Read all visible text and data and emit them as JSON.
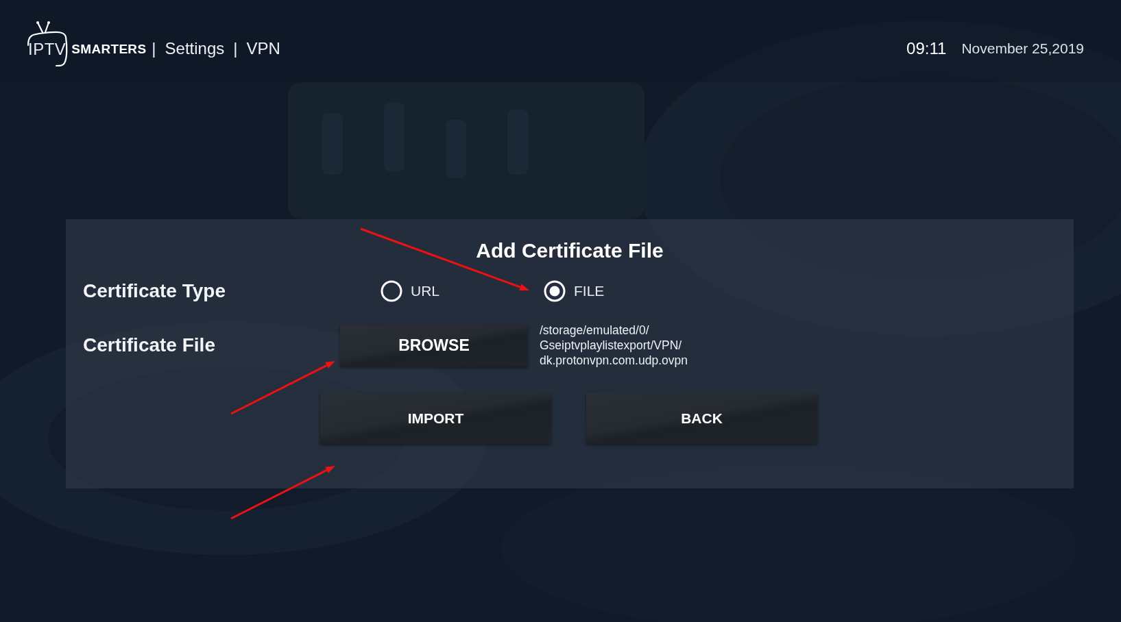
{
  "header": {
    "logo": {
      "left": "IPTV",
      "right": "SMARTERS"
    },
    "breadcrumb": [
      {
        "kind": "separator",
        "text": "|"
      },
      {
        "kind": "crumb",
        "text": "Settings"
      },
      {
        "kind": "separator",
        "text": "|"
      },
      {
        "kind": "crumb",
        "text": "VPN"
      }
    ],
    "time": "09:11",
    "date": "November 25,2019"
  },
  "dialog": {
    "title": "Add Certificate File",
    "fields": [
      {
        "kind": "radio",
        "label": "Certificate Type",
        "options": [
          {
            "label": "URL",
            "selected": false
          },
          {
            "label": "FILE",
            "selected": true
          }
        ]
      },
      {
        "kind": "file",
        "label": "Certificate File",
        "button": "BROWSE",
        "path": "/storage/emulated/0/\nGseiptvplaylistexport/VPN/\ndk.protonvpn.com.udp.ovpn"
      }
    ],
    "buttons": [
      "IMPORT",
      "BACK"
    ]
  }
}
